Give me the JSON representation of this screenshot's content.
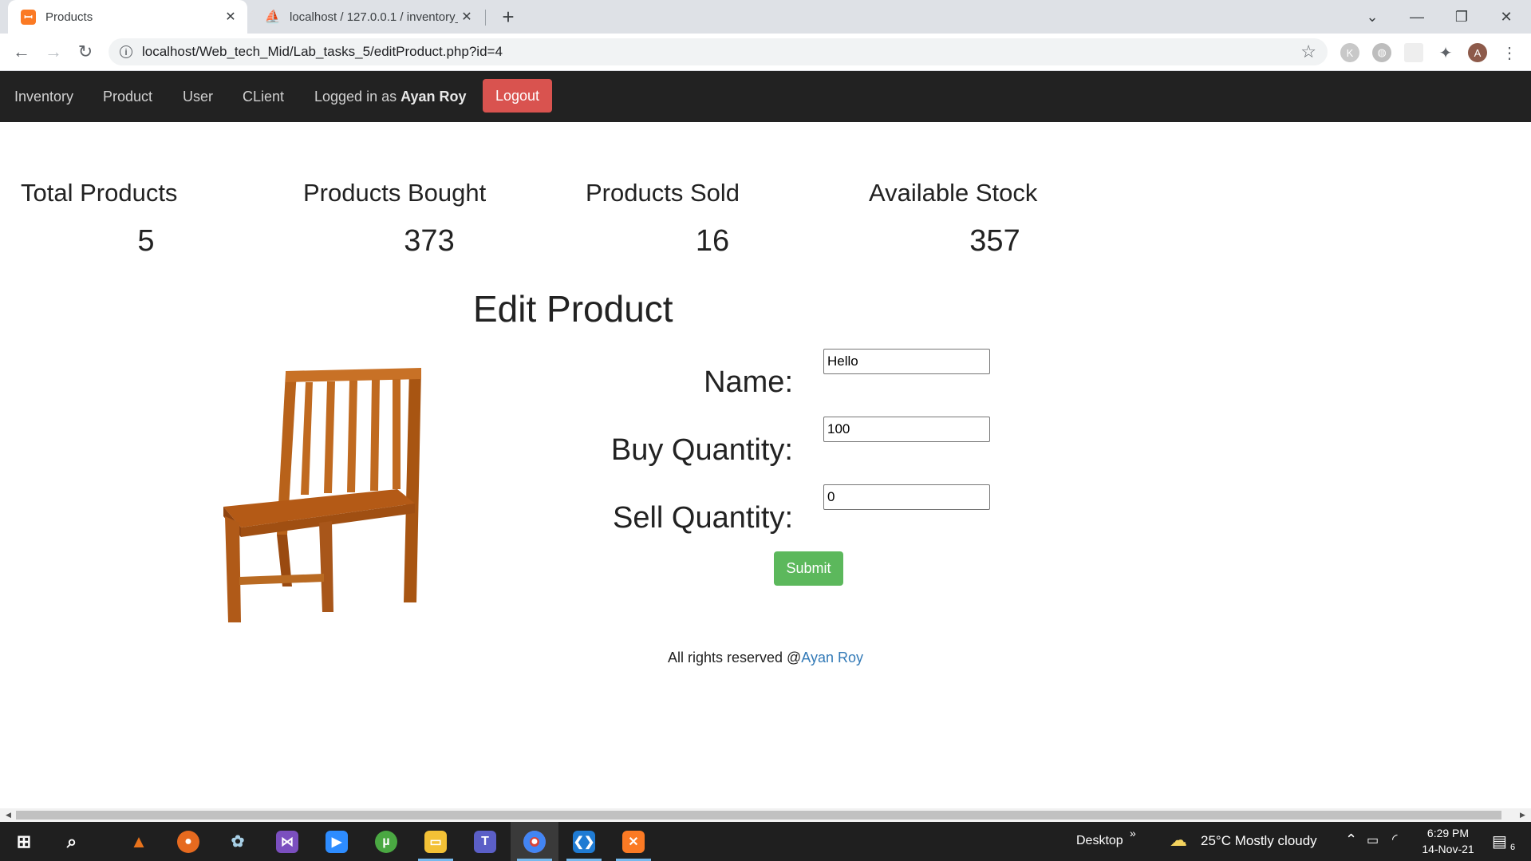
{
  "browser": {
    "tabs": [
      {
        "title": "Products",
        "favicon": "xampp-icon",
        "active": true
      },
      {
        "title": "localhost / 127.0.0.1 / inventory_p",
        "favicon": "phpmyadmin-icon",
        "active": false
      }
    ],
    "url": "localhost/Web_tech_Mid/Lab_tasks_5/editProduct.php?id=4",
    "profile_initial": "A",
    "ext_k": "K"
  },
  "nav": {
    "links": [
      "Inventory",
      "Product",
      "User",
      "CLient"
    ],
    "logged_in_prefix": "Logged in as",
    "username": "Ayan Roy",
    "logout": "Logout"
  },
  "stats": [
    {
      "label": "Total Products",
      "value": "5"
    },
    {
      "label": "Products Bought",
      "value": "373"
    },
    {
      "label": "Products Sold",
      "value": "16"
    },
    {
      "label": "Available Stock",
      "value": "357"
    }
  ],
  "form": {
    "heading": "Edit Product",
    "name_label": "Name:",
    "name_value": "Hello",
    "buy_label": "Buy Quantity:",
    "buy_value": "100",
    "sell_label": "Sell Quantity:",
    "sell_value": "0",
    "submit": "Submit"
  },
  "footer": {
    "text": "All rights reserved @",
    "link": "Ayan Roy"
  },
  "taskbar": {
    "desktop_label": "Desktop",
    "weather": "25°C  Mostly cloudy",
    "time": "6:29 PM",
    "date": "14-Nov-21",
    "notification_count": "6"
  },
  "colors": {
    "navbar": "#222222",
    "logout": "#d9534f",
    "submit": "#5cb85c",
    "link": "#337ab7"
  }
}
